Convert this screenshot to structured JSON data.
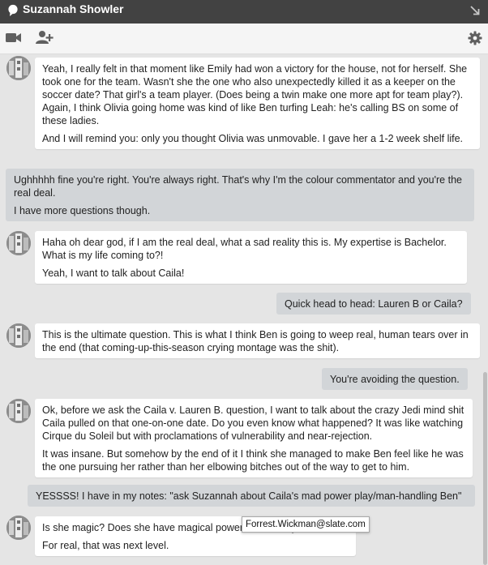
{
  "window": {
    "title": "Suzannah Showler",
    "icons": {
      "title": "chat-bubble-icon",
      "popout": "popout-arrow-icon",
      "video": "video-camera-icon",
      "add_person": "add-person-icon",
      "settings": "gear-icon"
    }
  },
  "colors": {
    "titlebar": "#424242",
    "toolbar": "#f5f5f5",
    "chat_background": "#e5e5e5",
    "incoming_bubble": "#ffffff",
    "outgoing_bubble": "#d2d5d8"
  },
  "messages": [
    {
      "from": "them",
      "lines": [
        "Yeah, I really felt in that moment like Emily had won a victory for the house, not for herself. She took one for the team. Wasn't she the one who also unexpectedly killed it as a keeper on the soccer date? That girl's a team player. (Does being a twin make one more apt for team play?). Again, I think Olivia going home was kind of like Ben turfing Leah: he's calling BS on some of these ladies.",
        "And I will remind you: only you thought Olivia was unmovable. I gave her a 1-2 week shelf life."
      ]
    },
    {
      "from": "me",
      "lines": [
        "Ughhhhh fine you're right. You're always right. That's why I'm the colour commentator and you're the real deal.",
        "I have more questions though."
      ]
    },
    {
      "from": "them",
      "lines": [
        "Haha oh dear god, if I am the real deal, what a sad reality this is. My expertise is Bachelor. What is my life coming to?!",
        "Yeah, I want to talk about Caila!"
      ]
    },
    {
      "from": "me",
      "lines": [
        "Quick head to head: Lauren B or Caila?"
      ]
    },
    {
      "from": "them",
      "lines": [
        "This is the ultimate question. This is what I think Ben is going to weep real, human tears over in the end (that coming-up-this-season crying montage was the shit)."
      ]
    },
    {
      "from": "me",
      "lines": [
        "You're avoiding the question."
      ]
    },
    {
      "from": "them",
      "lines": [
        "Ok, before we ask the Caila v. Lauren B. question, I want to talk about the crazy Jedi mind shit Caila pulled on that one-on-one date. Do you even know what happened? It was like watching Cirque du Soleil but with proclamations of vulnerability and near-rejection.",
        "It was insane. But somehow by the end of it I think she managed to make Ben feel like he was the one pursuing her rather than her elbowing bitches out of the way to get to him."
      ]
    },
    {
      "from": "me",
      "lines": [
        "YESSSS! I have in my notes: \"ask Suzannah about Caila's mad power play/man-handling Ben\""
      ]
    },
    {
      "from": "them",
      "lines": [
        "Is she magic? Does she have magical powers? Probably.",
        "For real, that was next level."
      ]
    }
  ],
  "tooltip": {
    "text": "Forrest.Wickman@slate.com"
  }
}
